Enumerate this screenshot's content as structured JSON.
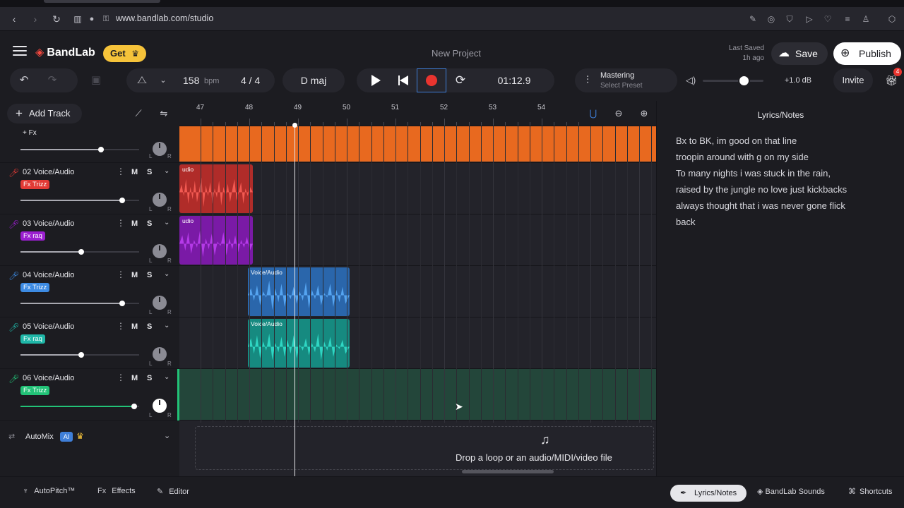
{
  "browser": {
    "url": "www.bandlab.com/studio",
    "icons": [
      "back-icon",
      "forward-icon",
      "reload-icon",
      "reader-icon",
      "mic-icon",
      "lock-icon",
      "edit-icon",
      "camera-icon",
      "shield-icon",
      "send-icon",
      "heart-icon",
      "menu-icon",
      "user-icon",
      "extension-icon"
    ]
  },
  "header": {
    "brand": "BandLab",
    "get_label": "Get",
    "project_title": "New Project",
    "last_saved_label": "Last Saved",
    "last_saved_value": "1h ago",
    "save_label": "Save",
    "publish_label": "Publish"
  },
  "toolbar": {
    "bpm": "158",
    "bpm_unit": "bpm",
    "time_signature": "4 / 4",
    "key": "D maj",
    "time": "01:12.9",
    "mastering_title": "Mastering",
    "mastering_sub": "Select Preset",
    "db": "+1.0 dB",
    "invite_label": "Invite",
    "gift_badge": "4",
    "volume": 0.68
  },
  "tracks_header": {
    "add_track_label": "Add Track",
    "first_fx_label": "+ Fx"
  },
  "tracks": [
    {
      "name": "02 Voice/Audio",
      "fx": "Fx Trizz",
      "color": "#e23a35",
      "volume": 0.86
    },
    {
      "name": "03 Voice/Audio",
      "fx": "Fx raq",
      "color": "#9b1fd0",
      "volume": 0.51
    },
    {
      "name": "04 Voice/Audio",
      "fx": "Fx Trizz",
      "color": "#3d8be3",
      "volume": 0.86
    },
    {
      "name": "05 Voice/Audio",
      "fx": "Fx raq",
      "color": "#1fb7a8",
      "volume": 0.51
    },
    {
      "name": "06 Voice/Audio",
      "fx": "Fx Trizz",
      "color": "#22c277",
      "volume": 0.96
    }
  ],
  "track_buttons": {
    "mute": "M",
    "solo": "S",
    "left": "L",
    "right": "R"
  },
  "automix": {
    "label": "AutoMix",
    "badge": "AI"
  },
  "ruler": {
    "bars": [
      "47",
      "48",
      "49",
      "50",
      "51",
      "52",
      "53",
      "54"
    ]
  },
  "clips": {
    "track2_label": "udio",
    "track3_label": "udio",
    "track4_label": "Voice/Audio",
    "track5_label": "Voice/Audio"
  },
  "drop_zone": {
    "text": "Drop a loop or an audio/MIDI/video file"
  },
  "lyrics": {
    "title": "Lyrics/Notes",
    "lines": [
      "Bx to BK, im good on that line",
      "troopin around with g on my side",
      "To many nights i was stuck in the rain,",
      "raised by the jungle no love just kickbacks",
      "always thought that i was never gone flick",
      "back"
    ]
  },
  "bottom": {
    "autopitch": "AutoPitch™",
    "effects": "Effects",
    "editor": "Editor",
    "lyrics_notes": "Lyrics/Notes",
    "sounds": "BandLab Sounds",
    "shortcuts": "Shortcuts"
  },
  "colors": {
    "accent": "#3f7fd8",
    "record": "#e9342f",
    "get": "#f6c33a",
    "orange_clip": "#e8691f"
  }
}
